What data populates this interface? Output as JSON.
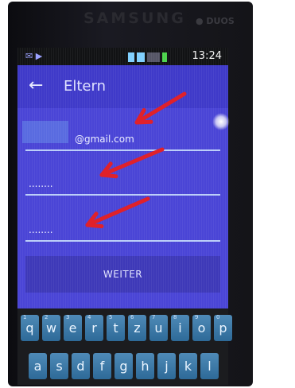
{
  "phone": {
    "brand": "SAMSUNG",
    "sensor_text": "● DUOS"
  },
  "status_bar": {
    "time": "13:24"
  },
  "app_bar": {
    "title": "Eltern"
  },
  "form": {
    "email_value": "@gmail.com",
    "password_value": "........",
    "confirm_value": "........",
    "submit_label": "WEITER"
  },
  "keyboard": {
    "row1": [
      {
        "k": "q",
        "n": "1"
      },
      {
        "k": "w",
        "n": "2"
      },
      {
        "k": "e",
        "n": "3"
      },
      {
        "k": "r",
        "n": "4"
      },
      {
        "k": "t",
        "n": "5"
      },
      {
        "k": "z",
        "n": "6"
      },
      {
        "k": "u",
        "n": "7"
      },
      {
        "k": "i",
        "n": "8"
      },
      {
        "k": "o",
        "n": "9"
      },
      {
        "k": "p",
        "n": "0"
      }
    ],
    "row2": [
      "a",
      "s",
      "d",
      "f",
      "g",
      "h",
      "j",
      "k",
      "l"
    ]
  },
  "annotation": {
    "arrow_color": "#e0212a"
  },
  "colors": {
    "screen": "#4a45d6",
    "appbar": "#3f3ac9",
    "key": "#2e6a98"
  }
}
